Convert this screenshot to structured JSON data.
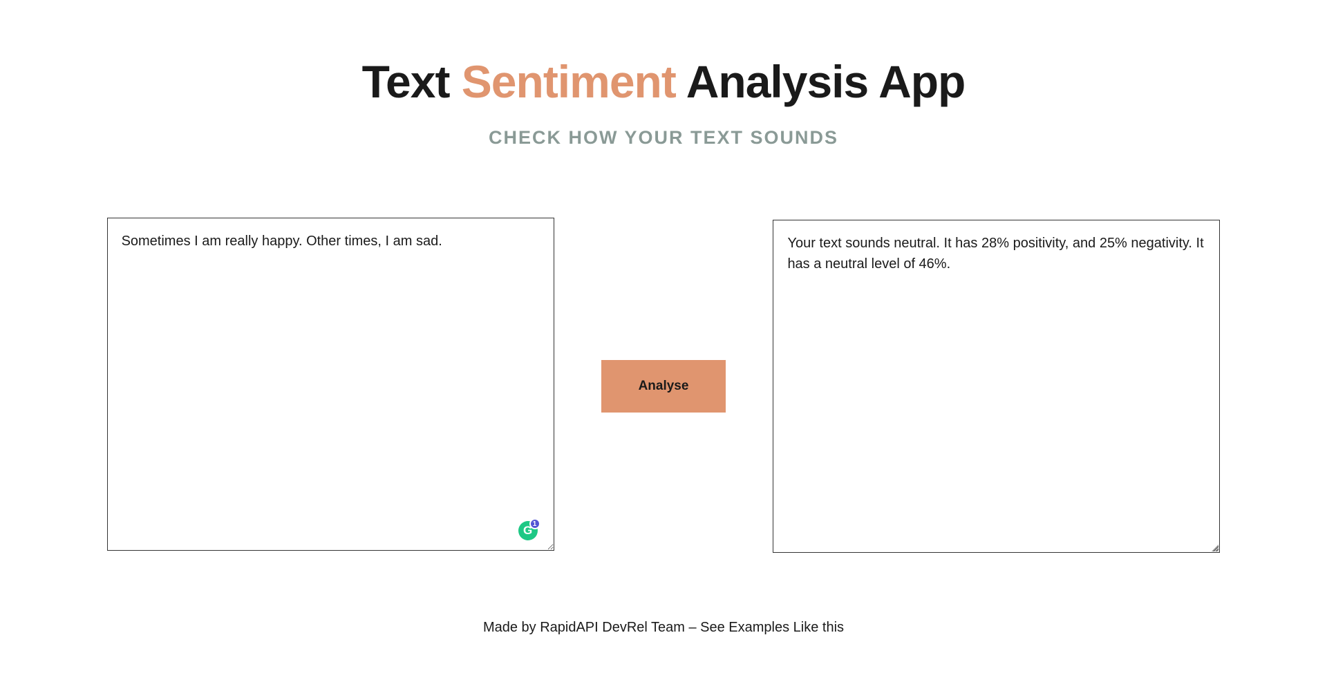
{
  "header": {
    "title_prefix": "Text ",
    "title_accent": "Sentiment",
    "title_suffix": " Analysis App",
    "subtitle": "CHECK HOW YOUR TEXT SOUNDS"
  },
  "input": {
    "text": "Sometimes I am really happy. Other times, I am sad."
  },
  "button": {
    "analyse_label": "Analyse"
  },
  "output": {
    "text": "Your text sounds neutral. It has 28% positivity, and 25% negativity. It has a neutral level of 46%."
  },
  "grammarly": {
    "badge_count": "1",
    "letter": "G"
  },
  "footer": {
    "text": "Made by RapidAPI DevRel Team – See Examples Like this"
  }
}
